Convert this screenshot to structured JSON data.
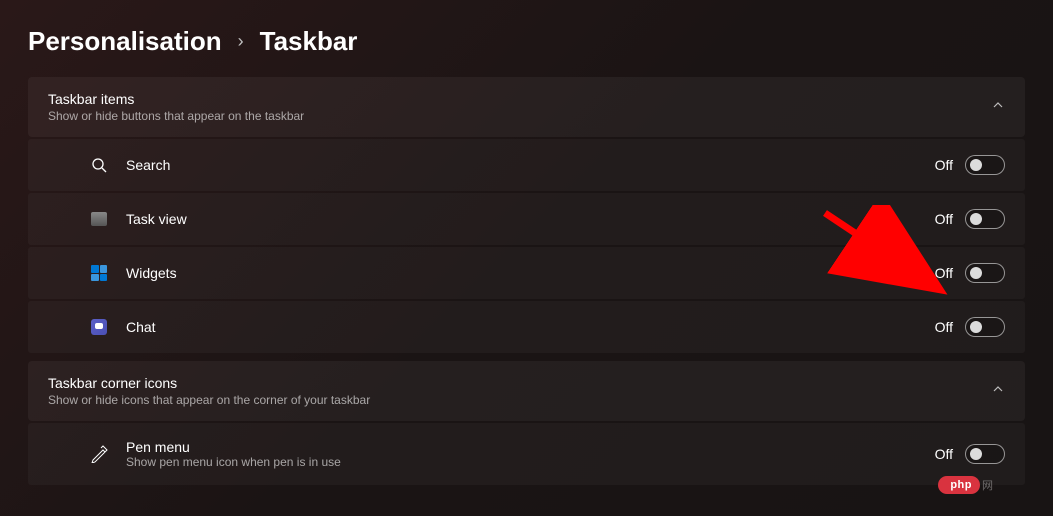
{
  "breadcrumb": {
    "parent": "Personalisation",
    "current": "Taskbar"
  },
  "sections": {
    "taskbar_items": {
      "title": "Taskbar items",
      "subtitle": "Show or hide buttons that appear on the taskbar",
      "items": {
        "search": {
          "label": "Search",
          "state": "Off"
        },
        "taskview": {
          "label": "Task view",
          "state": "Off"
        },
        "widgets": {
          "label": "Widgets",
          "state": "Off"
        },
        "chat": {
          "label": "Chat",
          "state": "Off"
        }
      }
    },
    "taskbar_corner": {
      "title": "Taskbar corner icons",
      "subtitle": "Show or hide icons that appear on the corner of your taskbar",
      "items": {
        "pen_menu": {
          "label": "Pen menu",
          "sublabel": "Show pen menu icon when pen is in use",
          "state": "Off"
        }
      }
    }
  },
  "watermark": {
    "pill": "php",
    "suffix": "网"
  }
}
